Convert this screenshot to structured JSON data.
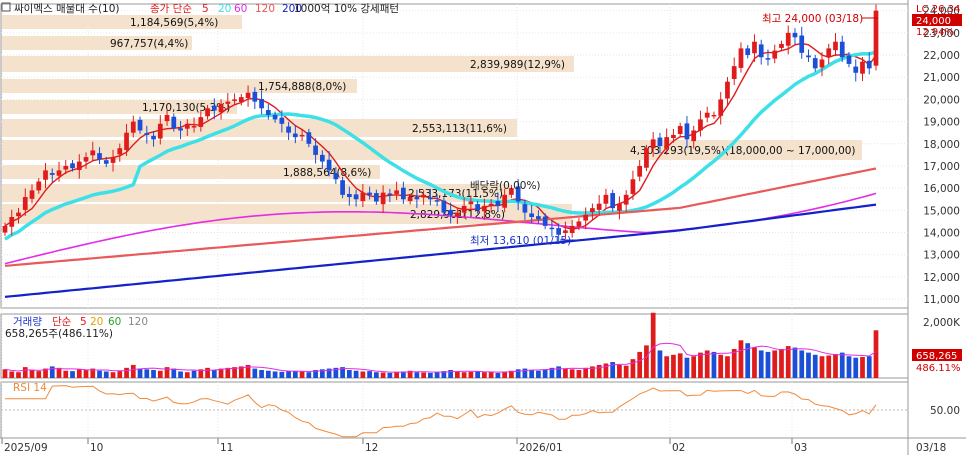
{
  "header": {
    "main_legend": {
      "security": "싸이멕스 매물대 수(10)",
      "ma_type": "종가 단순",
      "ma_periods": [
        "5",
        "20",
        "60",
        "120",
        "200"
      ],
      "pattern": "1000억 10% 강세패턴"
    },
    "volume_legend": {
      "label": "거래량",
      "ma_type": "단순",
      "ma_periods": [
        "5",
        "20",
        "60",
        "120"
      ],
      "volume_info": "658,265주(486.11%)"
    },
    "rsi_legend": "RSI 14"
  },
  "right_panel": {
    "price_info": "LC 26.34",
    "price_change": "12.94%",
    "current_price_badge": "24,000",
    "volume_badge": "658,265",
    "volume_pct": "486.11%"
  },
  "annotations": {
    "high": "최고 24,000 (03/18)",
    "low": "최저 13,610 (01/15)",
    "dividend": "배당락(0.00%)",
    "pattern_box": "4,303,293(19.5%)(18,000.00 ~ 17,000.00)"
  },
  "colors": {
    "up": "#e01b1b",
    "down": "#1a4fd6",
    "ma5": "#e01b1b",
    "ma20": "#3ee0e8",
    "ma60": "#e32ce8",
    "ma120": "#e85a5a",
    "ma200": "#1422c8",
    "profile": "#f5e2cc",
    "rsi": "#f08a3c"
  },
  "chart_data": [
    {
      "type": "candlestick",
      "title": "싸이멕스 매물대 수(10)",
      "y_ticks": [
        "24,000",
        "23,000",
        "22,000",
        "21,000",
        "20,000",
        "19,000",
        "18,000",
        "17,000",
        "16,000",
        "15,000",
        "14,000",
        "13,000",
        "12,000",
        "11,000"
      ],
      "ylim": [
        10600,
        24300
      ],
      "x_ticks": [
        "2025/09",
        "10",
        "11",
        "12",
        "2026/01",
        "02",
        "03"
      ],
      "x_end_label": "03/18",
      "high": {
        "value": 24000,
        "date": "03/18"
      },
      "low": {
        "value": 13610,
        "date": "01/15"
      },
      "close_series": [
        14300,
        14700,
        14900,
        15600,
        15900,
        16300,
        16800,
        16600,
        16800,
        17000,
        16900,
        17200,
        17400,
        17700,
        17300,
        17100,
        17400,
        17800,
        18500,
        19000,
        18600,
        18400,
        18200,
        18900,
        19300,
        18700,
        18600,
        18900,
        18800,
        19200,
        19600,
        19500,
        19800,
        19900,
        20000,
        20100,
        20300,
        19900,
        19600,
        19300,
        19100,
        18900,
        18500,
        18300,
        18400,
        18000,
        17500,
        17200,
        16800,
        16400,
        15700,
        15600,
        15500,
        15800,
        15700,
        15400,
        15800,
        15700,
        15900,
        15500,
        15600,
        15500,
        15700,
        15500,
        15400,
        14900,
        14800,
        14900,
        15200,
        15400,
        15000,
        15200,
        15300,
        15200,
        15700,
        16000,
        15400,
        14900,
        14700,
        14600,
        14300,
        14200,
        13900,
        14100,
        14300,
        14500,
        14800,
        15100,
        15300,
        15700,
        15100,
        15300,
        15700,
        16400,
        17000,
        17800,
        18200,
        17900,
        18300,
        18400,
        18800,
        18200,
        18600,
        19100,
        19400,
        19300,
        20000,
        20800,
        21500,
        22300,
        22000,
        22600,
        21900,
        21800,
        22200,
        22500,
        23000,
        22800,
        22100,
        21900,
        21400,
        21800,
        22300,
        22600,
        21900,
        21600,
        21200,
        21700,
        21400,
        24000
      ],
      "volume_series": [
        120,
        90,
        80,
        150,
        110,
        95,
        130,
        160,
        140,
        100,
        95,
        120,
        110,
        130,
        100,
        90,
        80,
        95,
        140,
        180,
        130,
        120,
        110,
        100,
        150,
        130,
        90,
        80,
        100,
        120,
        140,
        110,
        130,
        140,
        150,
        160,
        180,
        130,
        110,
        100,
        90,
        85,
        95,
        100,
        90,
        80,
        110,
        120,
        130,
        140,
        150,
        110,
        100,
        90,
        95,
        80,
        75,
        70,
        85,
        90,
        100,
        80,
        75,
        70,
        85,
        95,
        110,
        90,
        80,
        85,
        90,
        80,
        85,
        70,
        90,
        100,
        120,
        130,
        110,
        100,
        120,
        140,
        160,
        130,
        120,
        110,
        140,
        160,
        180,
        200,
        220,
        180,
        170,
        260,
        360,
        450,
        900,
        380,
        300,
        320,
        340,
        280,
        300,
        350,
        380,
        360,
        320,
        300,
        400,
        520,
        480,
        420,
        380,
        360,
        380,
        400,
        440,
        420,
        380,
        350,
        320,
        300,
        310,
        330,
        350,
        300,
        280,
        290,
        300,
        658
      ],
      "volume_ticks": [
        "2,000K"
      ],
      "rsi_ticks": [
        "50.00"
      ],
      "volume_profile": [
        {
          "label": "1,184,569(5,4%)"
        },
        {
          "label": "967,757(4,4%)"
        },
        {
          "label": "2,839,989(12,9%)"
        },
        {
          "label": "1,754,888(8,0%)"
        },
        {
          "label": "1,170,130(5,3%)"
        },
        {
          "label": "2,553,113(11,6%)"
        },
        {
          "label": "4,303,293(19,5%)(18,000,00 ~ 17,000,00)"
        },
        {
          "label": "1,888,564(8,6%)"
        },
        {
          "label": "2,533,173(11,5%)"
        },
        {
          "label": "2,829,961(12,8%)"
        }
      ]
    }
  ]
}
